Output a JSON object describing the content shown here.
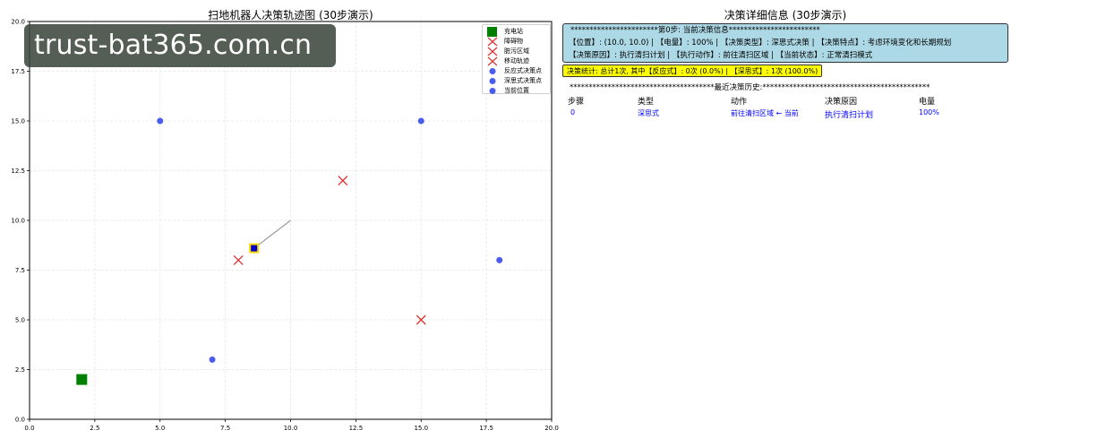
{
  "left_panel": {
    "title": "扫地机器人决策轨迹图 (30步演示)",
    "watermark": "trust-bat365.com.cn"
  },
  "chart_data": {
    "type": "scatter",
    "title": "扫地机器人决策轨迹图 (30步演示)",
    "xlabel": "",
    "ylabel": "",
    "xlim": [
      0,
      20
    ],
    "ylim": [
      0,
      20
    ],
    "grid": true,
    "legend_position": "top-right",
    "x_ticks": [
      "0.0",
      "2.5",
      "5.0",
      "7.5",
      "10.0",
      "12.5",
      "15.0",
      "17.5",
      "20.0"
    ],
    "y_ticks": [
      "0.0",
      "2.5",
      "5.0",
      "7.5",
      "10.0",
      "12.5",
      "15.0",
      "17.5",
      "20.0"
    ],
    "legend": [
      {
        "label": "充电站",
        "marker": "square",
        "color": "#008000"
      },
      {
        "label": "障碍物",
        "marker": "x",
        "color": "#e03030"
      },
      {
        "label": "脏污区域",
        "marker": "x",
        "color": "#e03030"
      },
      {
        "label": "移动轨迹",
        "marker": "x",
        "color": "#e03030"
      },
      {
        "label": "反应式决策点",
        "marker": "circle",
        "color": "#4a5cf0"
      },
      {
        "label": "深思式决策点",
        "marker": "circle",
        "color": "#4a5cf0"
      },
      {
        "label": "当前位置",
        "marker": "circle",
        "color": "#4a5cf0"
      }
    ],
    "series": [
      {
        "role": "charging_station",
        "marker": "square",
        "color": "#008000",
        "points": [
          [
            2,
            2
          ]
        ]
      },
      {
        "role": "obstacle",
        "marker": "x",
        "color": "#e03030",
        "points": [
          [
            8,
            8
          ],
          [
            12,
            12
          ],
          [
            15,
            5
          ]
        ]
      },
      {
        "role": "dirty_area",
        "marker": "circle",
        "color": "#4a5cf0",
        "points": [
          [
            5,
            15
          ],
          [
            15,
            15
          ],
          [
            7,
            3
          ],
          [
            18,
            8
          ]
        ]
      },
      {
        "role": "trajectory",
        "marker": "line",
        "color": "#999999",
        "points": [
          [
            10,
            10
          ],
          [
            8.6,
            8.6
          ]
        ]
      },
      {
        "role": "current_position",
        "marker": "square",
        "color": "#0000c8",
        "edge": "#ffd700",
        "points": [
          [
            8.6,
            8.6
          ]
        ]
      }
    ]
  },
  "right_panel": {
    "title": "决策详细信息 (30步演示)",
    "info_lines": [
      "***********************第0步: 当前决策信息************************",
      "【位置】: (10.0, 10.0) | 【电量】: 100% | 【决策类型】: 深思式决策 | 【决策特点】: 考虑环境变化和长期规划",
      "【决策原因】: 执行清扫计划 | 【执行动作】: 前往清扫区域 | 【当前状态】: 正常清扫模式"
    ],
    "stats": "决策统计: 总计1次, 其中【反应式】: 0次 (0.0%) | 【深思式】: 1次 (100.0%)",
    "history_title": "**************************************最近决策历史:********************************************",
    "history_headers": [
      "步骤",
      "类型",
      "动作",
      "决策原因",
      "电量"
    ],
    "history_rows": [
      {
        "step": "0",
        "type": "深思式",
        "action": "前往清扫区域 ← 当前",
        "reason": "执行清扫计划",
        "battery": "100%"
      }
    ]
  }
}
